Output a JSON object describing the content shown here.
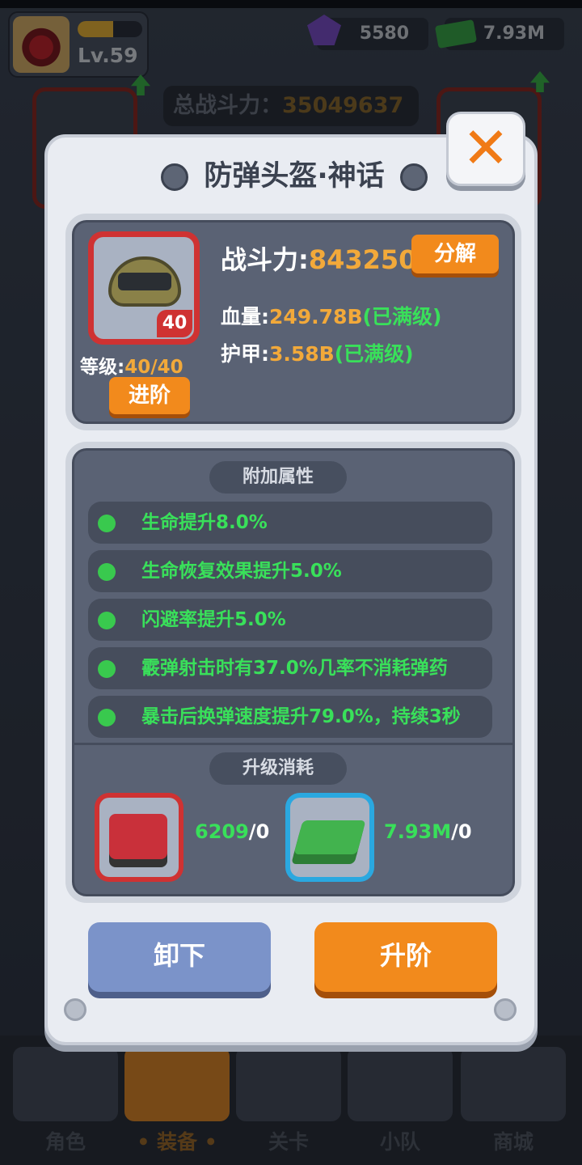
{
  "player": {
    "level": "Lv.59",
    "xp_fraction": 0.55
  },
  "resources": {
    "gems": "5580",
    "cash": "7.93M"
  },
  "total_power": {
    "label": "总战斗力：",
    "value": "35049637"
  },
  "bottom_nav": [
    {
      "label": "角色",
      "active": false
    },
    {
      "label": "• 装备 •",
      "active": true
    },
    {
      "label": "关卡",
      "active": false
    },
    {
      "label": "小队",
      "active": false
    },
    {
      "label": "商城",
      "active": false
    }
  ],
  "modal": {
    "title": "防弹头盔·神话",
    "close_label": "✕",
    "item": {
      "level_badge": "40",
      "grade_label": "等级:",
      "grade_value": "40/40",
      "advance_label": "进阶"
    },
    "power": {
      "label": "战斗力:",
      "value": "843250"
    },
    "decompose_label": "分解",
    "stats": {
      "hp_label": "血量:",
      "hp_value": "249.78B",
      "hp_max": "(已满级)",
      "armor_label": "护甲:",
      "armor_value": "3.58B",
      "armor_max": "(已满级)"
    },
    "attrs_title": "附加属性",
    "attrs": [
      "生命提升8.0%",
      "生命恢复效果提升5.0%",
      "闪避率提升5.0%",
      "霰弹射击时有37.0%几率不消耗弹药",
      "暴击后换弹速度提升79.0%，持续3秒"
    ],
    "cost_title": "升级消耗",
    "costs": [
      {
        "icon": "chip-icon",
        "have": "6209",
        "need": "/0"
      },
      {
        "icon": "cash-icon",
        "have": "7.93M",
        "need": "/0"
      }
    ],
    "unequip_label": "卸下",
    "upgrade_label": "升阶"
  }
}
